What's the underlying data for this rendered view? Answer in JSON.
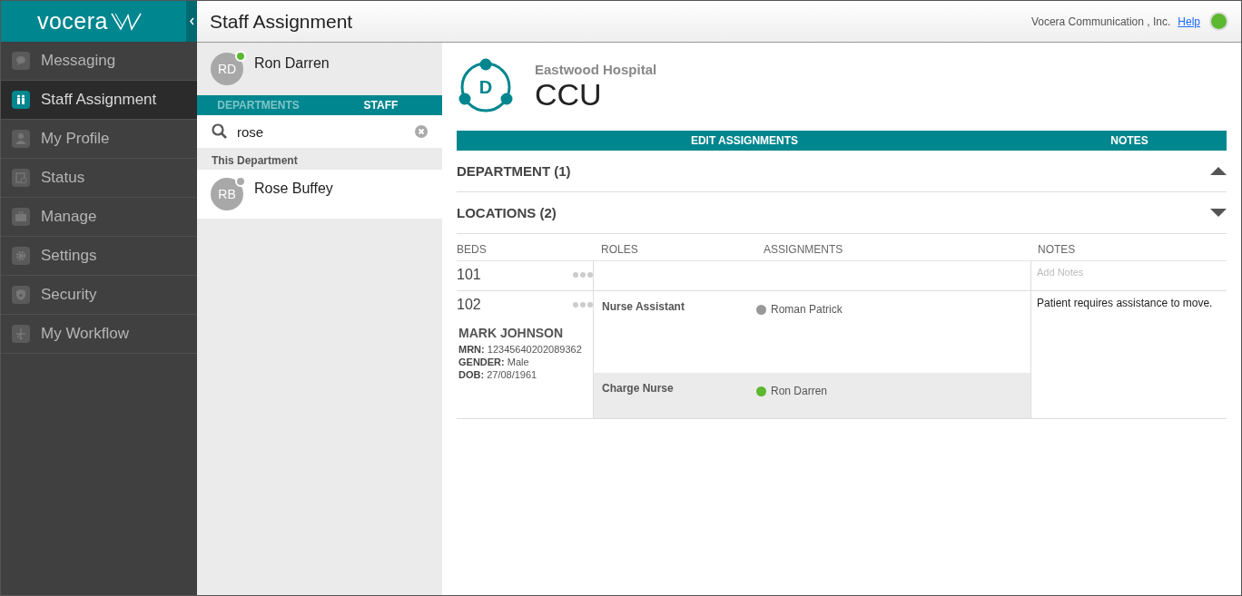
{
  "brand": {
    "logo_text": "vocera"
  },
  "sidebar": {
    "items": [
      {
        "label": "Messaging",
        "selected": false
      },
      {
        "label": "Staff Assignment",
        "selected": true
      },
      {
        "label": "My Profile",
        "selected": false
      },
      {
        "label": "Status",
        "selected": false
      },
      {
        "label": "Manage",
        "selected": false
      },
      {
        "label": "Settings",
        "selected": false
      },
      {
        "label": "Security",
        "selected": false
      },
      {
        "label": "My Workflow",
        "selected": false
      }
    ]
  },
  "header": {
    "title": "Staff Assignment",
    "company": "Vocera Communication , Inc.",
    "help_link": "Help",
    "online": true
  },
  "staff_panel": {
    "current_user": {
      "initials": "RD",
      "name": "Ron Darren",
      "color": "#5cb82e"
    },
    "tabs": [
      {
        "label": "DEPARTMENTS",
        "selected": false
      },
      {
        "label": "STAFF",
        "selected": true
      }
    ],
    "search": {
      "value": "rose"
    },
    "group_label": "This Department",
    "results": [
      {
        "initials": "RB",
        "name": "Rose Buffey",
        "color": "#aaaaaa"
      }
    ]
  },
  "department": {
    "hospital": "Eastwood Hospital",
    "name": "CCU",
    "icon_letter": "D",
    "actions": [
      "EDIT ASSIGNMENTS",
      "NOTES"
    ],
    "sections": [
      {
        "title": "DEPARTMENT (1)",
        "expanded": false
      },
      {
        "title": "LOCATIONS (2)",
        "expanded": true
      }
    ],
    "table": {
      "columns": [
        "BEDS",
        "ROLES",
        "ASSIGNMENTS",
        "NOTES"
      ],
      "rows": [
        {
          "bed": "101",
          "notes_placeholder": "Add Notes"
        },
        {
          "bed": "102",
          "patient": {
            "name": "MARK JOHNSON",
            "fields": [
              {
                "label": "MRN:",
                "value": "12345640202089362"
              },
              {
                "label": "GENDER:",
                "value": "Male"
              },
              {
                "label": "DOB:",
                "value": "27/08/1961"
              }
            ]
          },
          "roles": [
            {
              "role": "Nurse Assistant",
              "assignee": "Roman Patrick",
              "color": "#999999",
              "highlighted": false
            },
            {
              "role": "Charge Nurse",
              "assignee": "Ron Darren",
              "color": "#5cb82e",
              "highlighted": true
            }
          ],
          "notes": "Patient requires assistance to move."
        }
      ]
    }
  }
}
